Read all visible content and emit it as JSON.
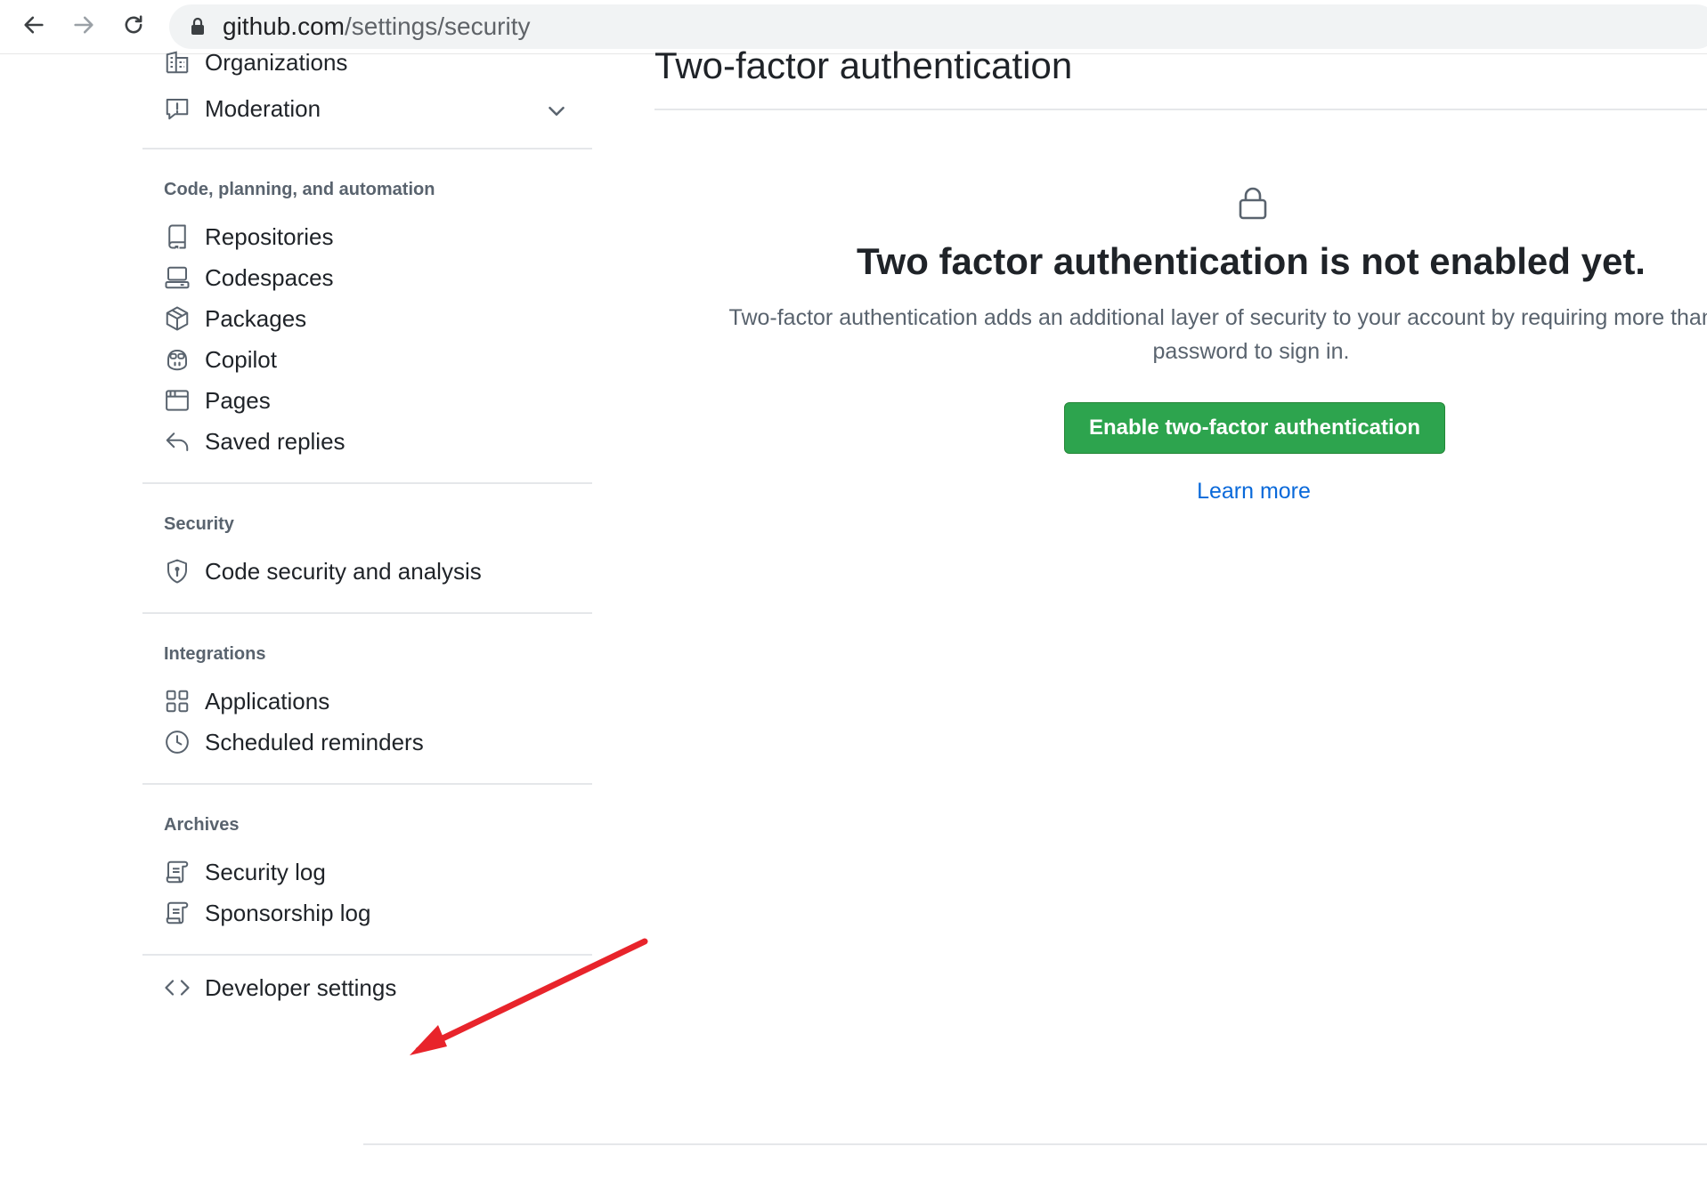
{
  "browser": {
    "url_host": "github.com",
    "url_path": "/settings/security"
  },
  "sidebar": {
    "top_items": [
      {
        "label": "Organizations",
        "icon": "organization-icon"
      },
      {
        "label": "Moderation",
        "icon": "report-icon"
      }
    ],
    "sections": [
      {
        "heading": "Code, planning, and automation",
        "items": [
          {
            "label": "Repositories",
            "icon": "repo-icon"
          },
          {
            "label": "Codespaces",
            "icon": "codespaces-icon"
          },
          {
            "label": "Packages",
            "icon": "package-icon"
          },
          {
            "label": "Copilot",
            "icon": "copilot-icon"
          },
          {
            "label": "Pages",
            "icon": "browser-icon"
          },
          {
            "label": "Saved replies",
            "icon": "reply-icon"
          }
        ]
      },
      {
        "heading": "Security",
        "items": [
          {
            "label": "Code security and analysis",
            "icon": "shield-icon"
          }
        ]
      },
      {
        "heading": "Integrations",
        "items": [
          {
            "label": "Applications",
            "icon": "apps-icon"
          },
          {
            "label": "Scheduled reminders",
            "icon": "clock-icon"
          }
        ]
      },
      {
        "heading": "Archives",
        "items": [
          {
            "label": "Security log",
            "icon": "log-icon"
          },
          {
            "label": "Sponsorship log",
            "icon": "log-icon"
          }
        ]
      }
    ],
    "developer_settings": {
      "label": "Developer settings",
      "icon": "code-icon"
    }
  },
  "main": {
    "title": "Two-factor authentication",
    "blankslate": {
      "icon": "lock-icon",
      "heading": "Two factor authentication is not enabled yet.",
      "description_line1": "Two-factor authentication adds an additional layer of security to your account by requiring more than just a",
      "description_line2": "password to sign in.",
      "button_label": "Enable two-factor authentication",
      "link_label": "Learn more"
    }
  },
  "colors": {
    "primary_button": "#2da44e",
    "link": "#0969da",
    "annotation_arrow": "#e8242b"
  }
}
